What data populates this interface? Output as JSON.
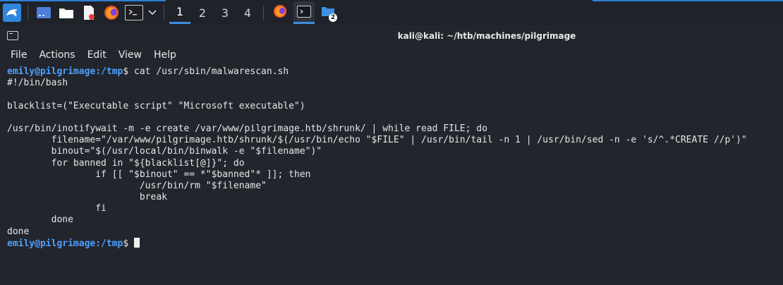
{
  "taskbar": {
    "workspaces": [
      "1",
      "2",
      "3",
      "4"
    ],
    "active_workspace": "1",
    "badge_count": "2",
    "accent_color": "#3d8fe0"
  },
  "window": {
    "title": "kali@kali: ~/htb/machines/pilgrimage"
  },
  "menu": [
    "File",
    "Actions",
    "Edit",
    "View",
    "Help"
  ],
  "terminal": {
    "prompt_user": "emily@pilgrimage",
    "prompt_path": ":/tmp",
    "prompt_symbol": "$",
    "command": " cat /usr/sbin/malwarescan.sh",
    "output": [
      "#!/bin/bash",
      "",
      "blacklist=(\"Executable script\" \"Microsoft executable\")",
      "",
      "/usr/bin/inotifywait -m -e create /var/www/pilgrimage.htb/shrunk/ | while read FILE; do",
      "        filename=\"/var/www/pilgrimage.htb/shrunk/$(/usr/bin/echo \"$FILE\" | /usr/bin/tail -n 1 | /usr/bin/sed -n -e 's/^.*CREATE //p')\"",
      "        binout=\"$(/usr/local/bin/binwalk -e \"$filename\")\"",
      "        for banned in \"${blacklist[@]}\"; do",
      "                if [[ \"$binout\" == *\"$banned\"* ]]; then",
      "                        /usr/bin/rm \"$filename\"",
      "                        break",
      "                fi",
      "        done",
      "done"
    ]
  }
}
